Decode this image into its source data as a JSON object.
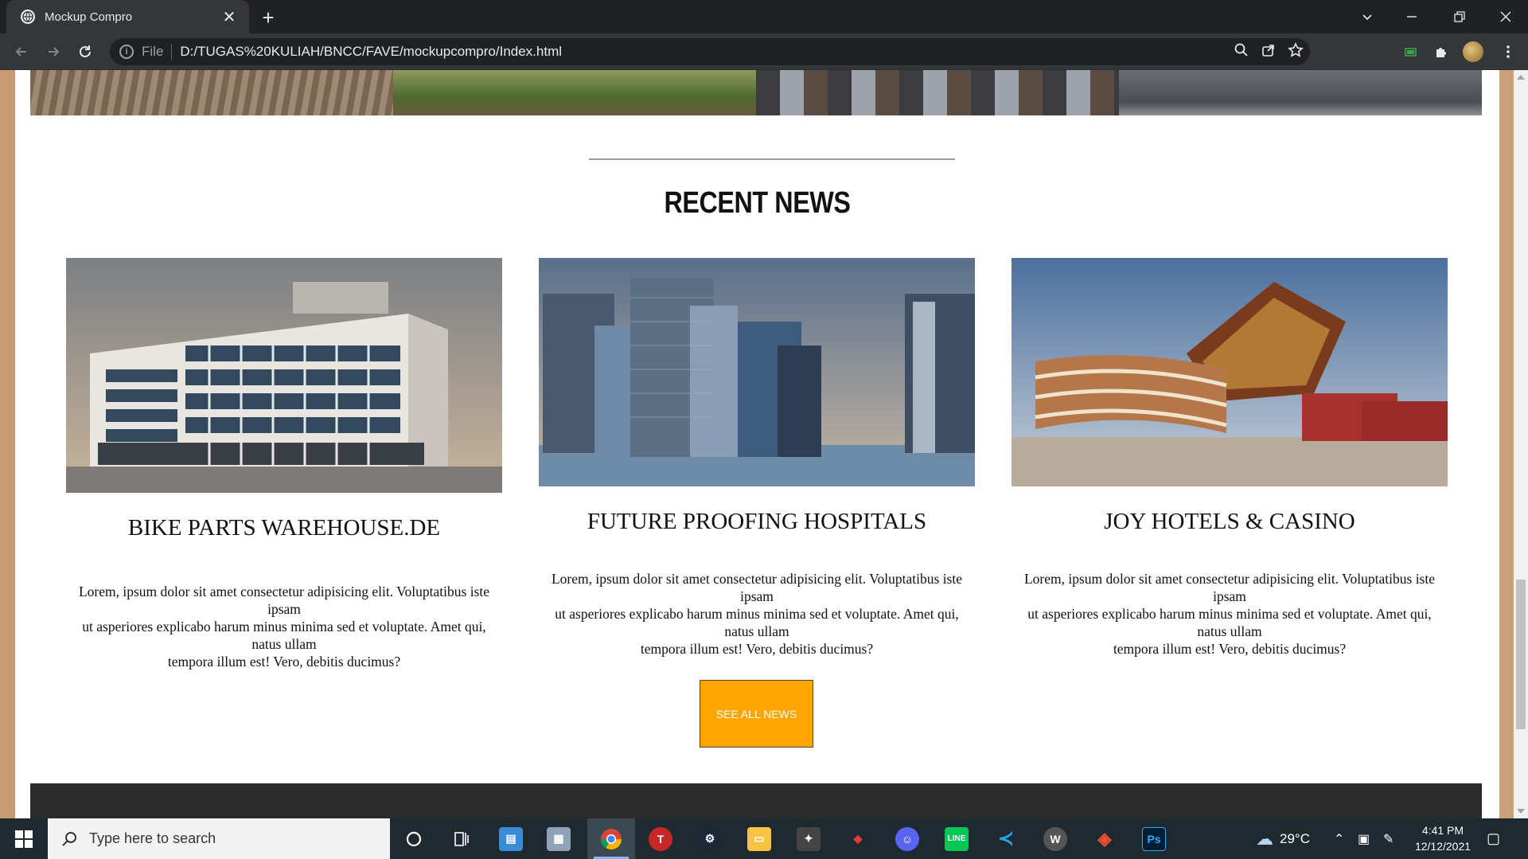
{
  "browser": {
    "tab_title": "Mockup Compro",
    "url_scheme": "File",
    "url": "D:/TUGAS%20KULIAH/BNCC/FAVE/mockupcompro/Index.html"
  },
  "page": {
    "section_title": "RECENT NEWS",
    "cards": [
      {
        "title": "BIKE PARTS WAREHOUSE.DE",
        "body": [
          "Lorem, ipsum dolor sit amet consectetur adipisicing elit. Voluptatibus iste ipsam",
          "ut asperiores explicabo harum minus minima sed et voluptate. Amet qui, natus ullam",
          "tempora illum est! Vero, debitis ducimus?"
        ]
      },
      {
        "title": "FUTURE PROOFING HOSPITALS",
        "body": [
          "Lorem, ipsum dolor sit amet consectetur adipisicing elit. Voluptatibus iste ipsam",
          "ut asperiores explicabo harum minus minima sed et voluptate. Amet qui, natus ullam",
          "tempora illum est! Vero, debitis ducimus?"
        ]
      },
      {
        "title": "JOY HOTELS & CASINO",
        "body": [
          "Lorem, ipsum dolor sit amet consectetur adipisicing elit. Voluptatibus iste ipsam",
          "ut asperiores explicabo harum minus minima sed et voluptate. Amet qui, natus ullam",
          "tempora illum est! Vero, debitis ducimus?"
        ]
      }
    ],
    "see_all_label": "SEE ALL NEWS"
  },
  "taskbar": {
    "search_placeholder": "Type here to search",
    "weather": "29°C",
    "time": "4:41 PM",
    "date": "12/12/2021",
    "apps": [
      "cortana-icon",
      "task-view-icon",
      "control-panel-icon",
      "photos-icon",
      "chrome-icon",
      "todo-icon",
      "steam-icon",
      "file-explorer-icon",
      "blender-icon",
      "game-icon",
      "discord-icon",
      "line-icon",
      "vscode-icon",
      "wamp-icon",
      "git-icon",
      "photoshop-icon"
    ]
  },
  "colors": {
    "accent_button": "#ffa500",
    "chrome_dark": "#202124",
    "taskbar": "#1f2a30"
  }
}
